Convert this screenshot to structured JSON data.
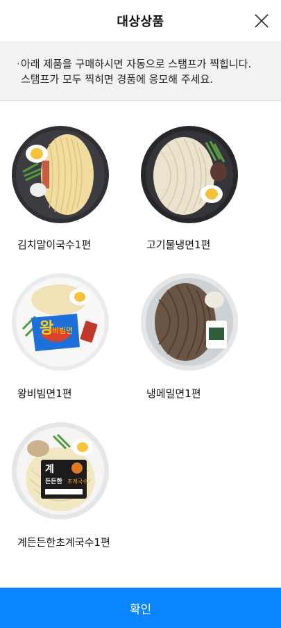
{
  "header": {
    "title": "대상상품",
    "close_icon": "close-icon"
  },
  "notice": {
    "lines": [
      "아래 제품을 구매하시면 자동으로 스탬프가 찍힙니다.",
      "스탬프가 모두 찍히면 경품에 응모해 주세요."
    ]
  },
  "products": [
    {
      "name": "김치말이국수1편",
      "image": "kimchi-mari-guksu-image"
    },
    {
      "name": "고기물냉면1편",
      "image": "gogi-mul-naengmyeon-image"
    },
    {
      "name": "왕비빔면1편",
      "image": "wang-bibimmyeon-image"
    },
    {
      "name": "냉메밀면1편",
      "image": "naeng-memil-myeon-image"
    },
    {
      "name": "계든든한초계국수1편",
      "image": "gyedeundeun-chogye-guksu-image"
    }
  ],
  "product_badges": {
    "wang_brand": "왕",
    "wang_sub": "비빔면",
    "chogye_brand_top": "계",
    "chogye_brand_mid": "든든한",
    "chogye_sub": "초계국수"
  },
  "confirm_button": {
    "label": "확인"
  },
  "colors": {
    "accent": "#0a84ff",
    "notice_bg": "#f2f2f2"
  }
}
